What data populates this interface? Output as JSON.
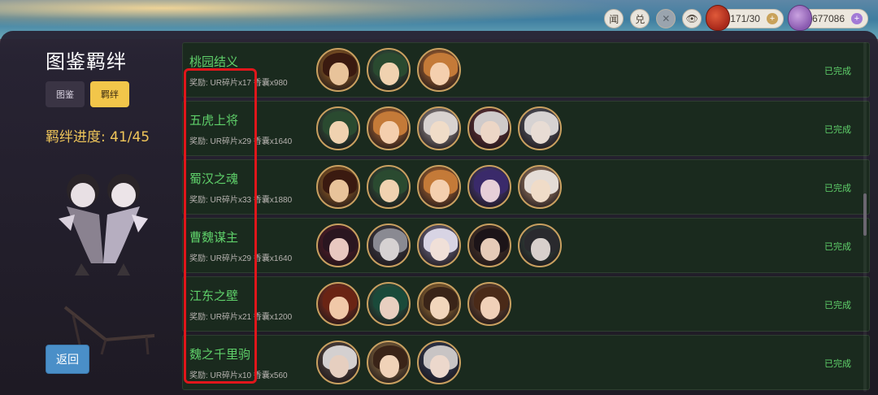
{
  "topbar": {
    "btn1": "闻",
    "btn2": "兑",
    "btn3": "✕",
    "btn4": "👁",
    "resource1": "171/30",
    "resource2": "677086",
    "plus": "+"
  },
  "sidebar": {
    "title": "图鉴羁绊",
    "tab_catalog": "图鉴",
    "tab_bond": "羁绊",
    "progress": "羁绊进度: 41/45",
    "back": "返回"
  },
  "bonds": [
    {
      "name": "桃园结义",
      "reward": "奖励: UR碎片x17  香囊x980",
      "status": "已完成",
      "avatars": [
        [
          "#e8c39a",
          "#3a1a10",
          "#c07a2a"
        ],
        [
          "#f0d2b0",
          "#2a4a30",
          "#3a6a48"
        ],
        [
          "#f4cfae",
          "#c47a38",
          "#d8803a"
        ]
      ]
    },
    {
      "name": "五虎上将",
      "reward": "奖励: UR碎片x29  香囊x1640",
      "status": "已完成",
      "avatars": [
        [
          "#f0d2b0",
          "#2a4a30",
          "#3a6a48"
        ],
        [
          "#f4cfae",
          "#c47a38",
          "#d8803a"
        ],
        [
          "#f0dcc8",
          "#d8d2d0",
          "#b8b0b0"
        ],
        [
          "#ecd6c6",
          "#cfcaca",
          "#7a3a40"
        ],
        [
          "#e8dcd4",
          "#d6d2d2",
          "#6a6e7a"
        ]
      ]
    },
    {
      "name": "蜀汉之魂",
      "reward": "奖励: UR碎片x33  香囊x1880",
      "status": "已完成",
      "avatars": [
        [
          "#e8c39a",
          "#3a1a10",
          "#c07a2a"
        ],
        [
          "#f0d2b0",
          "#2a4a30",
          "#3a6a48"
        ],
        [
          "#f4cfae",
          "#c47a38",
          "#d8803a"
        ],
        [
          "#e6cfd8",
          "#3a2a6a",
          "#5a4aa0"
        ],
        [
          "#f0dcc8",
          "#e4dcd6",
          "#c9a080"
        ]
      ]
    },
    {
      "name": "曹魏谋主",
      "reward": "奖励: UR碎片x29  香囊x1640",
      "status": "已完成",
      "avatars": [
        [
          "#e8c8c0",
          "#2a1620",
          "#6a2030"
        ],
        [
          "#d6d2d2",
          "#8a8a92",
          "#4a4a54"
        ],
        [
          "#f0e0d8",
          "#d8d4e4",
          "#8a86a8"
        ],
        [
          "#e6cbb8",
          "#1c1418",
          "#5a4030"
        ],
        [
          "#d8d0cc",
          "#2a2a2e",
          "#3e5a50"
        ]
      ]
    },
    {
      "name": "江东之壁",
      "reward": "奖励: UR碎片x21  香囊x1200",
      "status": "已完成",
      "avatars": [
        [
          "#f0c8a8",
          "#6a2414",
          "#b03a20"
        ],
        [
          "#e8cfc0",
          "#1a4a3a",
          "#2e7a5a"
        ],
        [
          "#f2d6bc",
          "#3a2418",
          "#c89040"
        ],
        [
          "#f0d0b8",
          "#4a2a18",
          "#8a5a3a"
        ]
      ]
    },
    {
      "name": "魏之千里驹",
      "reward": "奖励: UR碎片x10  香囊x560",
      "status": "已完成",
      "avatars": [
        [
          "#e6cfc0",
          "#d4d0d0",
          "#6a5a50"
        ],
        [
          "#f0d2b8",
          "#3a2418",
          "#b08a50"
        ],
        [
          "#ecd8cc",
          "#c8c4c4",
          "#3a4a6a"
        ]
      ]
    }
  ]
}
